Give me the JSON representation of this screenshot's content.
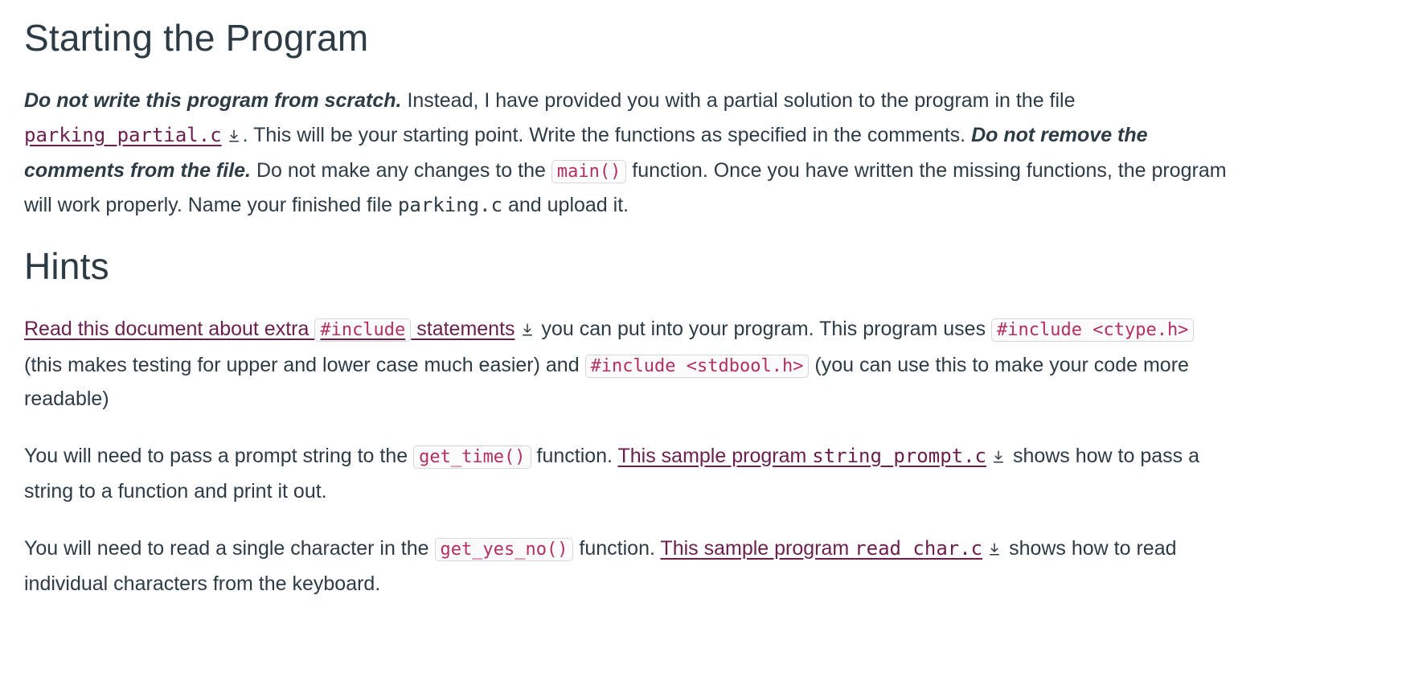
{
  "section1": {
    "heading": "Starting the Program",
    "p1": {
      "lead_bi": "Do not write this program from scratch.",
      "t1": " Instead, I have provided you with a partial solution to the program in the file ",
      "link_file": "parking_partial.c",
      "t2": ". This will be your starting point. Write the functions as specified in the comments.  ",
      "bi2": "Do not remove the comments from the file.",
      "t3": " Do not make any changes to the ",
      "code1": "main()",
      "t4": " function. Once you have written the missing functions, the program will work properly. Name your finished file ",
      "mono1": "parking.c",
      "t5": " and upload it."
    }
  },
  "section2": {
    "heading": "Hints",
    "p1": {
      "link_pre": "Read this document about extra ",
      "link_code": "#include",
      "link_post": " statements",
      "t1": " you can put into your program. This program uses  ",
      "code1": "#include <ctype.h>",
      "t2": " (this makes testing for upper and lower case much easier) and ",
      "code2": "#include <stdbool.h>",
      "t3": " (you can use this to make your code more readable)"
    },
    "p2": {
      "t1": "You will need to pass a prompt string to the ",
      "code1": "get_time()",
      "t2": " function. ",
      "link_pre": "This sample program ",
      "link_mono": "string_prompt.c",
      "t3": " shows how to pass a string to a function and print it out."
    },
    "p3": {
      "t1": "You will need to read a single character in the ",
      "code1": "get_yes_no()",
      "t2": " function. ",
      "link_pre": "This sample program ",
      "link_mono": "read_char.c",
      "t3": " shows how to read individual characters from the keyboard."
    }
  }
}
